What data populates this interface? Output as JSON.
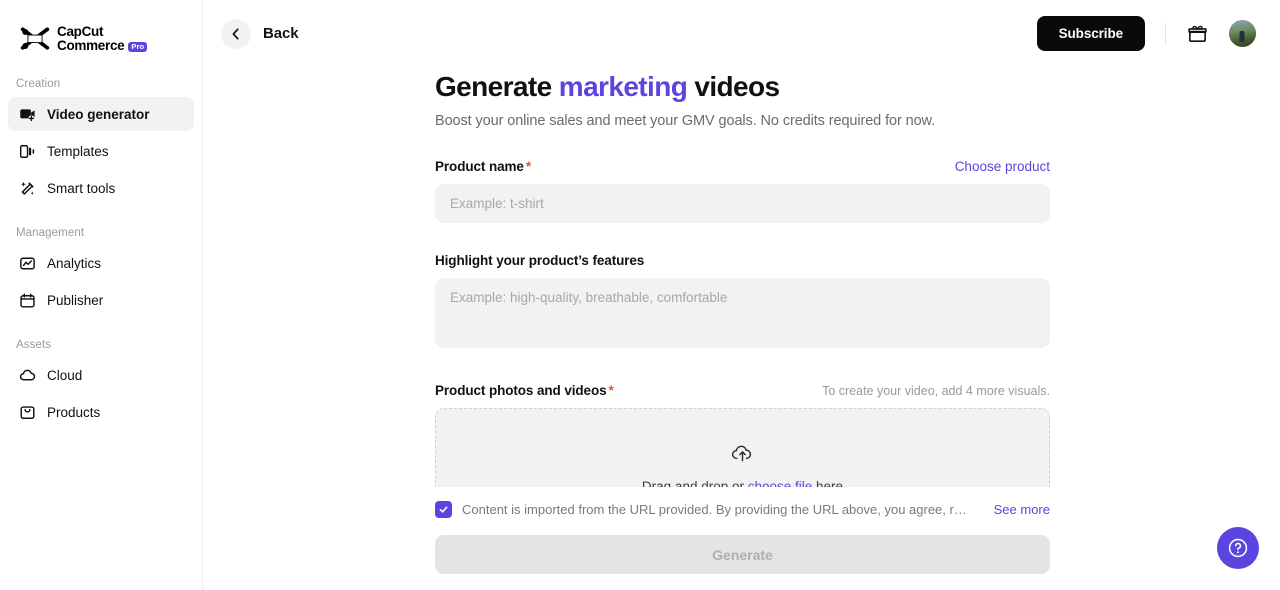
{
  "brand": {
    "logo_line1": "CapCut",
    "logo_line2": "Commerce",
    "pro_badge": "Pro",
    "accent_color": "#5B45E0",
    "required_color": "#F5483B"
  },
  "sidebar": {
    "sections": [
      {
        "label": "Creation",
        "items": [
          {
            "label": "Video generator",
            "icon": "video-generator-icon",
            "active": true
          },
          {
            "label": "Templates",
            "icon": "templates-icon",
            "active": false
          },
          {
            "label": "Smart tools",
            "icon": "smart-tools-icon",
            "active": false
          }
        ]
      },
      {
        "label": "Management",
        "items": [
          {
            "label": "Analytics",
            "icon": "analytics-icon",
            "active": false
          },
          {
            "label": "Publisher",
            "icon": "publisher-icon",
            "active": false
          }
        ]
      },
      {
        "label": "Assets",
        "items": [
          {
            "label": "Cloud",
            "icon": "cloud-icon",
            "active": false
          },
          {
            "label": "Products",
            "icon": "products-icon",
            "active": false
          }
        ]
      }
    ]
  },
  "topbar": {
    "back_label": "Back",
    "back_icon": "chevron-left-icon",
    "subscribe_label": "Subscribe",
    "gift_icon": "gift-icon",
    "avatar_icon": "user-avatar"
  },
  "main": {
    "title_part1": "Generate ",
    "title_accent": "marketing",
    "title_part2": " videos",
    "subtitle": "Boost your online sales and meet your GMV goals. No credits required for now.",
    "fields": {
      "product_name": {
        "label": "Product name",
        "required_mark": "*",
        "action_link": "Choose product",
        "value": "",
        "placeholder": "Example: t-shirt"
      },
      "features": {
        "label": "Highlight your product’s features",
        "value": "",
        "placeholder": "Example: high-quality, breathable, comfortable"
      },
      "media": {
        "label": "Product photos and videos",
        "required_mark": "*",
        "hint": "To create your video, add 4 more visuals.",
        "dropzone_pre": "Drag and drop or ",
        "dropzone_link": "choose file",
        "dropzone_post": " here",
        "dropzone_icon": "cloud-upload-icon"
      }
    }
  },
  "footer": {
    "checkbox_checked": true,
    "checkbox_icon": "check-icon",
    "consent_text": "Content is imported from the URL provided. By providing the URL above, you agree, r…",
    "see_more_label": "See more",
    "generate_label": "Generate",
    "generate_disabled": true
  },
  "help": {
    "icon": "question-mark-icon",
    "label": "Help"
  }
}
